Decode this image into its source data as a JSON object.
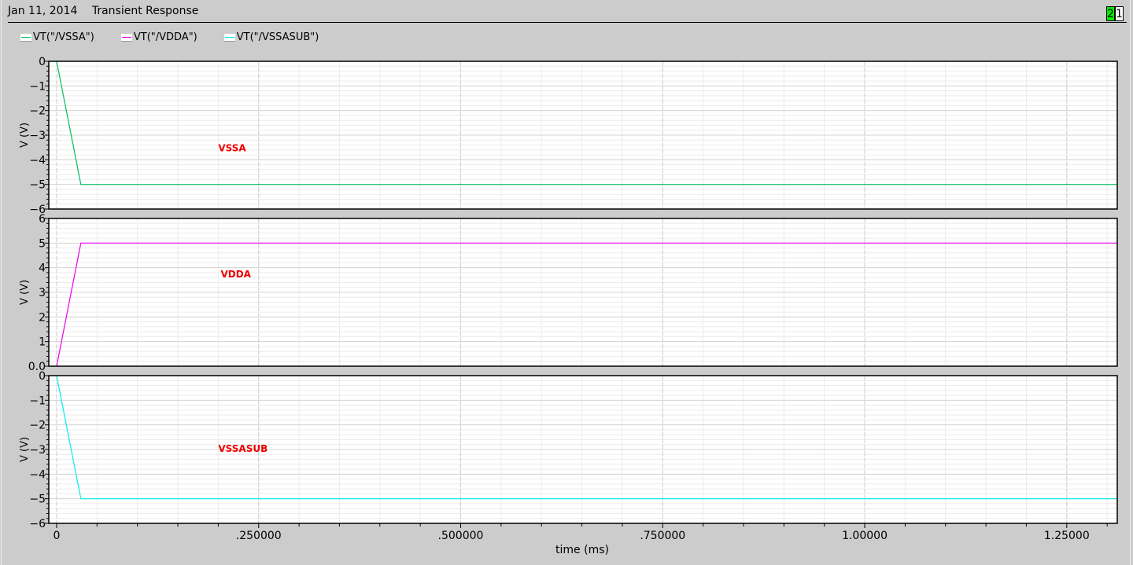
{
  "header": {
    "date": "Jan 11, 2014",
    "title": "Transient Response"
  },
  "badges": [
    {
      "label": "2",
      "color": "#00ee00"
    },
    {
      "label": "1",
      "color": "#ffffff"
    }
  ],
  "legend": [
    {
      "label": "VT(\"/VSSA\")",
      "color": "#00c060"
    },
    {
      "label": "VT(\"/VDDA\")",
      "color": "#ee00ee"
    },
    {
      "label": "VT(\"/VSSASUB\")",
      "color": "#00eeee"
    }
  ],
  "chart_data": {
    "type": "line",
    "xlabel": "time (ms)",
    "xlim": [
      -0.0097,
      1.3125
    ],
    "xticks": [
      0,
      0.25,
      0.5,
      0.75,
      1.0,
      1.25
    ],
    "xtick_labels": [
      "0",
      ".250000",
      ".500000",
      ".750000",
      "1.00000",
      "1.25000"
    ],
    "annotation_color": "#ee0000",
    "panels": [
      {
        "name": "VSSA",
        "ylabel": "V (V)",
        "ylim": [
          -6,
          0
        ],
        "yticks": [
          0,
          -1,
          -2,
          -3,
          -4,
          -5,
          -6
        ],
        "ytick_labels": [
          "0",
          "-1",
          "-2",
          "-3",
          "-4",
          "-5",
          "-6"
        ],
        "color": "#00c060",
        "points": [
          [
            0,
            0
          ],
          [
            0.03,
            -5
          ],
          [
            1.3125,
            -5
          ]
        ],
        "annotation": {
          "text": "VSSA",
          "x": 0.2,
          "y": -3.65
        }
      },
      {
        "name": "VDDA",
        "ylabel": "V (V)",
        "ylim": [
          0,
          6
        ],
        "yticks": [
          6,
          5,
          4,
          3,
          2,
          1,
          0
        ],
        "ytick_labels": [
          "6",
          "5",
          "4",
          "3",
          "2",
          "1",
          "0.0"
        ],
        "color": "#ee00ee",
        "points": [
          [
            0,
            0
          ],
          [
            0.03,
            5
          ],
          [
            1.3125,
            5
          ]
        ],
        "annotation": {
          "text": "VDDA",
          "x": 0.203,
          "y": 3.6
        }
      },
      {
        "name": "VSSASUB",
        "ylabel": "V (V)",
        "ylim": [
          -6,
          0
        ],
        "yticks": [
          0,
          -1,
          -2,
          -3,
          -4,
          -5,
          -6
        ],
        "ytick_labels": [
          "0",
          "-1",
          "-2",
          "-3",
          "-4",
          "-5",
          "-6"
        ],
        "color": "#00eeee",
        "points": [
          [
            0,
            0
          ],
          [
            0.03,
            -5
          ],
          [
            1.3125,
            -5
          ]
        ],
        "annotation": {
          "text": "VSSASUB",
          "x": 0.2,
          "y": -3.1
        }
      }
    ]
  }
}
